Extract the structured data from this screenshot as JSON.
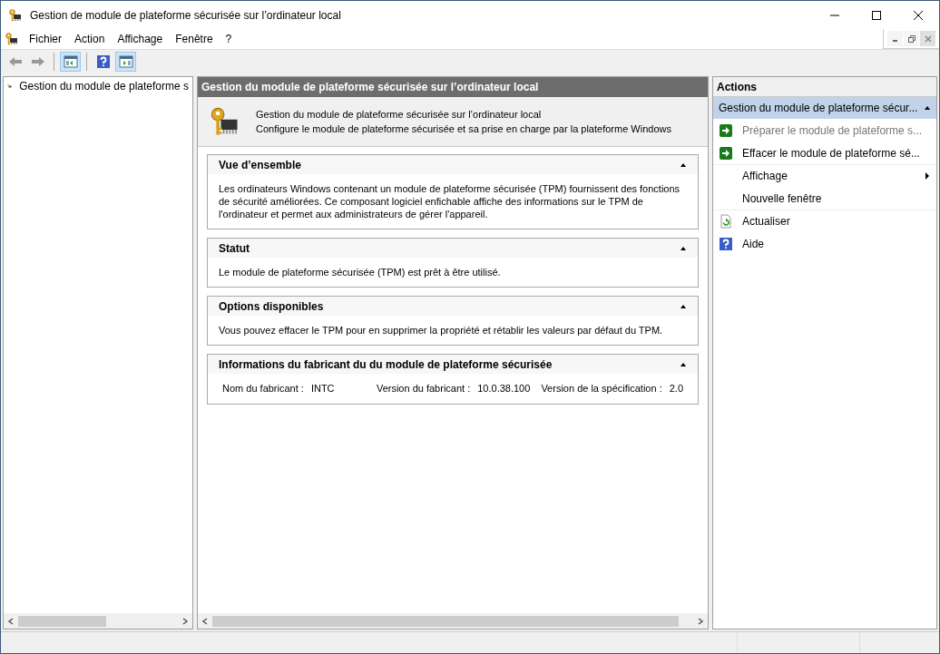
{
  "window": {
    "title": "Gestion de module de plateforme sécurisée sur l’ordinateur local"
  },
  "menu": [
    "Fichier",
    "Action",
    "Affichage",
    "Fenêtre",
    "?"
  ],
  "toolbar": [
    {
      "kind": "back",
      "pressed": false
    },
    {
      "kind": "forward",
      "pressed": false
    },
    {
      "kind": "tree",
      "pressed": true
    },
    {
      "kind": "help",
      "pressed": false
    },
    {
      "kind": "actionpane",
      "pressed": true
    }
  ],
  "tree": {
    "items": [
      {
        "label": "Gestion du module de plateforme s"
      }
    ]
  },
  "center": {
    "header": "Gestion du module de plateforme sécurisée sur l’ordinateur local",
    "intro": [
      "Gestion du module de plateforme sécurisée sur l’ordinateur local",
      "Configure le module de plateforme sécurisée et sa prise en charge par la plateforme Windows"
    ],
    "sections": [
      {
        "kind": "text",
        "title": "Vue d’ensemble",
        "text": "Les ordinateurs Windows contenant un module de plateforme sécurisée (TPM) fournissent des fonctions de sécurité améliorées. Ce composant logiciel enfichable affiche des informations sur le TPM de l'ordinateur et permet aux administrateurs de gérer l'appareil.",
        "expanded": true
      },
      {
        "kind": "text",
        "title": "Statut",
        "text": "Le module de plateforme sécurisée (TPM) est prêt à être utilisé.",
        "expanded": true
      },
      {
        "kind": "text",
        "title": "Options disponibles",
        "text": "Vous pouvez effacer le TPM pour en supprimer la propriété et rétablir les valeurs par défaut du TPM.",
        "expanded": true
      },
      {
        "kind": "fields",
        "title": "Informations du fabricant du du module de plateforme sécurisée",
        "expanded": true,
        "fields": [
          {
            "label": "Nom du fabricant :",
            "value": "INTC"
          },
          {
            "label": "Version du fabricant :",
            "value": "10.0.38.100"
          },
          {
            "label": "Version de la spécification :",
            "value": "2.0"
          }
        ]
      }
    ]
  },
  "actions": {
    "title": "Actions",
    "group": "Gestion du module de plateforme sécur...",
    "items": [
      {
        "kind": "arrow",
        "label": "Préparer le module de plateforme s...",
        "disabled": true
      },
      {
        "kind": "arrow",
        "label": "Effacer le module de plateforme sé...",
        "disabled": false
      },
      {
        "kind": "submenu",
        "label": "Affichage",
        "disabled": false
      },
      {
        "kind": "plain",
        "label": "Nouvelle fenêtre",
        "disabled": false
      },
      {
        "kind": "refresh",
        "label": "Actualiser",
        "disabled": false
      },
      {
        "kind": "help",
        "label": "Aide",
        "disabled": false
      }
    ]
  }
}
